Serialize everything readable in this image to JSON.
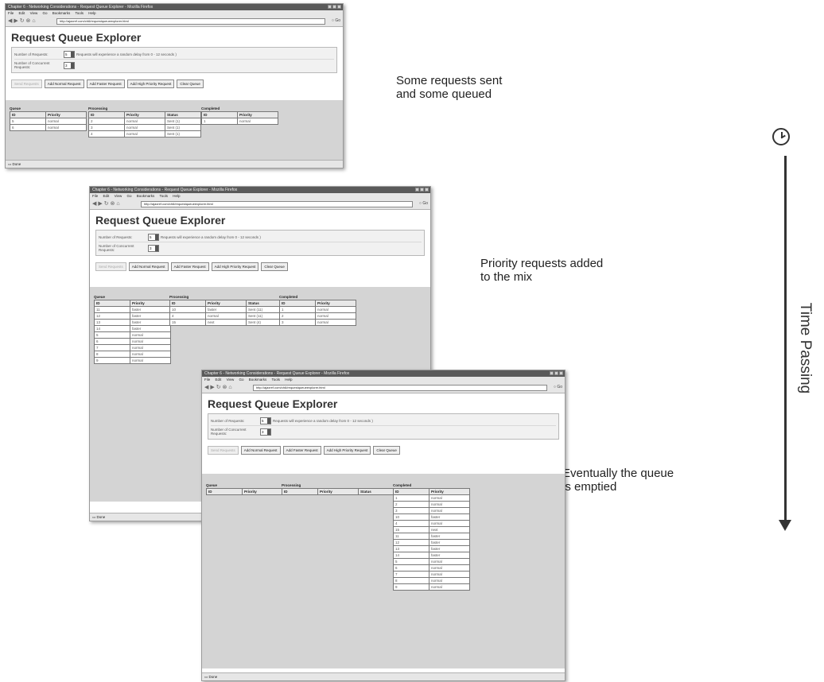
{
  "browser": {
    "window_title": "Chapter 6 - Networking Considerations - Request Queue Explorer - Mozilla Firefox",
    "menu": [
      "File",
      "Edit",
      "View",
      "Go",
      "Bookmarks",
      "Tools",
      "Help"
    ],
    "url": "http://ajaxref.com/ch6/requestqueueexplorer.html",
    "go_label": "Go",
    "status_text": "Done"
  },
  "app": {
    "title": "Request Queue Explorer",
    "num_requests_label": "Number of Requests:",
    "num_requests_value": "5",
    "random_delay_note": "Requests will experience a random delay from 0 - 12 seconds )",
    "concurrent_label": "Number of Concurrent Requests:",
    "concurrent_value": "3",
    "buttons": {
      "send": "Send Requests",
      "add_normal": "Add Normal Request",
      "add_faster": "Add Faster Request",
      "add_high": "Add High Priority Request",
      "clear": "Clear Queue"
    },
    "headings": {
      "queue": "Queue",
      "processing": "Processing",
      "completed": "Completed",
      "id": "ID",
      "priority": "Priority",
      "status": "Status"
    }
  },
  "snapshots": [
    {
      "caption": "Some requests sent\nand some queued",
      "queue": [
        {
          "id": "5",
          "priority": "normal"
        },
        {
          "id": "6",
          "priority": "normal"
        }
      ],
      "processing": [
        {
          "id": "2",
          "priority": "normal",
          "status": "Sent (1)"
        },
        {
          "id": "3",
          "priority": "normal",
          "status": "Sent (1)"
        },
        {
          "id": "4",
          "priority": "normal",
          "status": "Sent (1)"
        }
      ],
      "completed": [
        {
          "id": "1",
          "priority": "normal"
        }
      ]
    },
    {
      "caption": "Priority requests added\nto the mix",
      "queue": [
        {
          "id": "11",
          "priority": "faster"
        },
        {
          "id": "12",
          "priority": "faster"
        },
        {
          "id": "13",
          "priority": "faster"
        },
        {
          "id": "14",
          "priority": "faster"
        },
        {
          "id": "5",
          "priority": "normal"
        },
        {
          "id": "6",
          "priority": "normal"
        },
        {
          "id": "7",
          "priority": "normal"
        },
        {
          "id": "8",
          "priority": "normal"
        },
        {
          "id": "9",
          "priority": "normal"
        }
      ],
      "processing": [
        {
          "id": "10",
          "priority": "faster",
          "status": "Sent (11)"
        },
        {
          "id": "4",
          "priority": "normal",
          "status": "Sent (11)"
        },
        {
          "id": "15",
          "priority": "next",
          "status": "Sent (4)"
        }
      ],
      "completed": [
        {
          "id": "1",
          "priority": "normal"
        },
        {
          "id": "2",
          "priority": "normal"
        },
        {
          "id": "3",
          "priority": "normal"
        }
      ]
    },
    {
      "caption": "Eventually the queue\nis emptied",
      "queue": [],
      "processing": [],
      "completed": [
        {
          "id": "1",
          "priority": "normal"
        },
        {
          "id": "2",
          "priority": "normal"
        },
        {
          "id": "3",
          "priority": "normal"
        },
        {
          "id": "10",
          "priority": "faster"
        },
        {
          "id": "4",
          "priority": "normal"
        },
        {
          "id": "15",
          "priority": "next"
        },
        {
          "id": "11",
          "priority": "faster"
        },
        {
          "id": "12",
          "priority": "faster"
        },
        {
          "id": "13",
          "priority": "faster"
        },
        {
          "id": "14",
          "priority": "faster"
        },
        {
          "id": "5",
          "priority": "normal"
        },
        {
          "id": "6",
          "priority": "normal"
        },
        {
          "id": "7",
          "priority": "normal"
        },
        {
          "id": "8",
          "priority": "normal"
        },
        {
          "id": "9",
          "priority": "normal"
        }
      ]
    }
  ],
  "timeline": {
    "label": "Time Passing",
    "icon": "clock-icon"
  }
}
